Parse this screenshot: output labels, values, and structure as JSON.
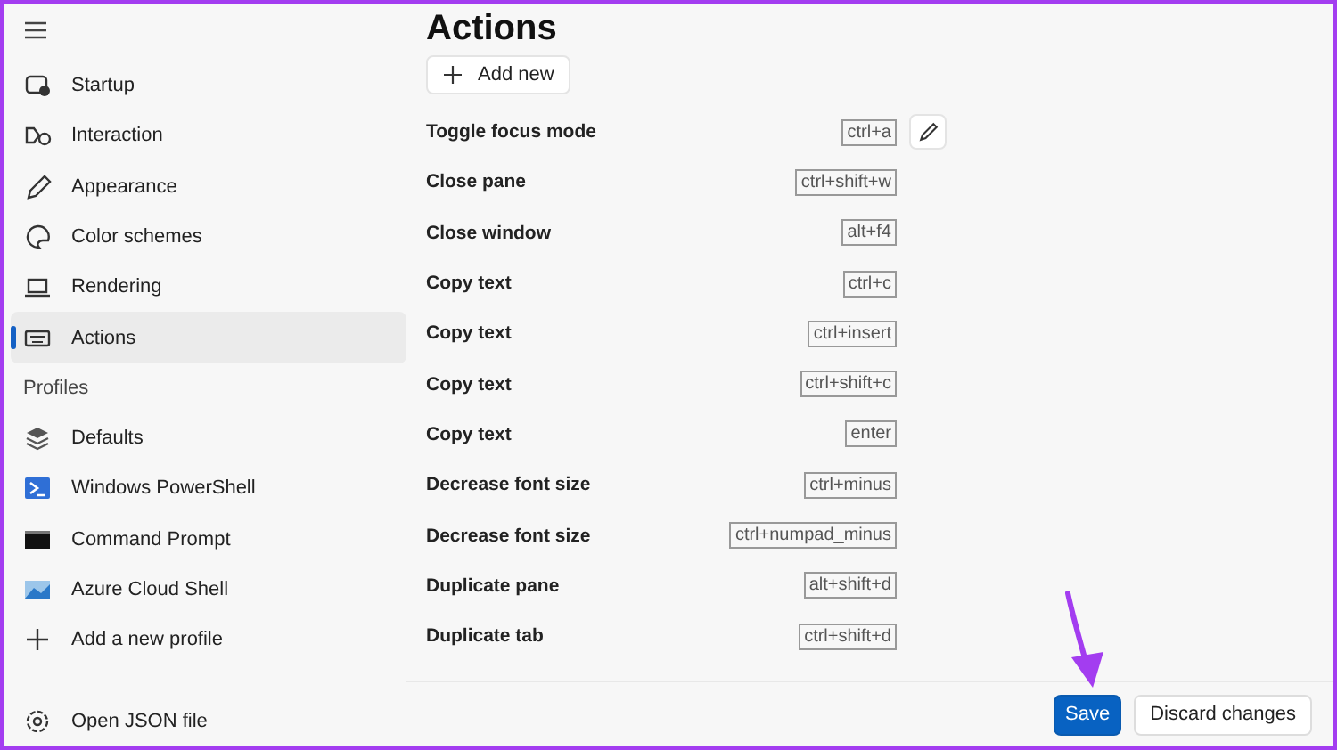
{
  "nav": [
    {
      "label": "Startup",
      "selected": false
    },
    {
      "label": "Interaction",
      "selected": false
    },
    {
      "label": "Appearance",
      "selected": false
    },
    {
      "label": "Color schemes",
      "selected": false
    },
    {
      "label": "Rendering",
      "selected": false
    },
    {
      "label": "Actions",
      "selected": true
    }
  ],
  "profiles_heading": "Profiles",
  "profiles": [
    {
      "label": "Defaults"
    },
    {
      "label": "Windows PowerShell"
    },
    {
      "label": "Command Prompt"
    },
    {
      "label": "Azure Cloud Shell"
    },
    {
      "label": "Add a new profile"
    }
  ],
  "open_json": "Open JSON file",
  "title": "Actions",
  "add_button": "Add new",
  "actions": [
    {
      "name": "Toggle focus mode",
      "keys": "ctrl+a",
      "editing": true
    },
    {
      "name": "Close pane",
      "keys": "ctrl+shift+w",
      "editing": false
    },
    {
      "name": "Close window",
      "keys": "alt+f4",
      "editing": false
    },
    {
      "name": "Copy text",
      "keys": "ctrl+c",
      "editing": false
    },
    {
      "name": "Copy text",
      "keys": "ctrl+insert",
      "editing": false
    },
    {
      "name": "Copy text",
      "keys": "ctrl+shift+c",
      "editing": false
    },
    {
      "name": "Copy text",
      "keys": "enter",
      "editing": false
    },
    {
      "name": "Decrease font size",
      "keys": "ctrl+minus",
      "editing": false
    },
    {
      "name": "Decrease font size",
      "keys": "ctrl+numpad_minus",
      "editing": false
    },
    {
      "name": "Duplicate pane",
      "keys": "alt+shift+d",
      "editing": false
    },
    {
      "name": "Duplicate tab",
      "keys": "ctrl+shift+d",
      "editing": false
    }
  ],
  "buttons": [
    {
      "label": "Save",
      "kind": "primary"
    },
    {
      "label": "Discard changes",
      "kind": "secondary"
    }
  ]
}
